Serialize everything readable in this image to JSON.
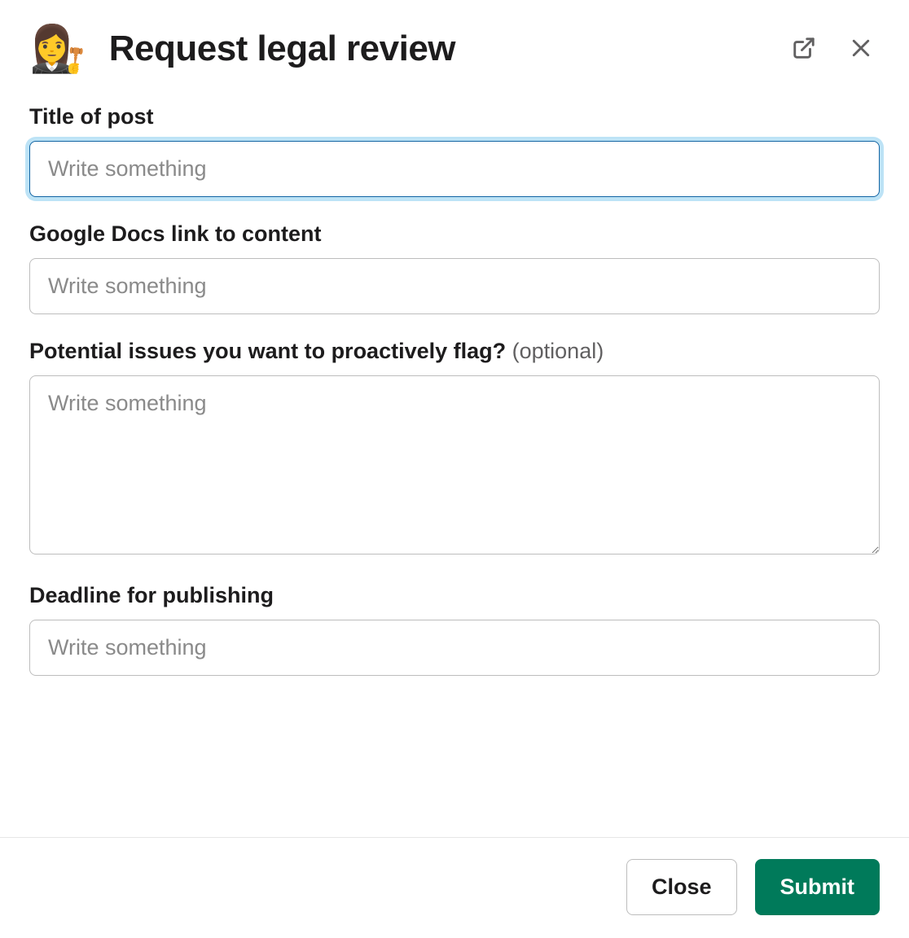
{
  "header": {
    "icon": "👩‍⚖️",
    "title": "Request legal review"
  },
  "fields": {
    "title_of_post": {
      "label": "Title of post",
      "placeholder": "Write something",
      "value": ""
    },
    "gdocs_link": {
      "label": "Google Docs link to content",
      "placeholder": "Write something",
      "value": ""
    },
    "issues": {
      "label": "Potential issues you want to proactively flag? ",
      "optional_text": "(optional)",
      "placeholder": "Write something",
      "value": ""
    },
    "deadline": {
      "label": "Deadline for publishing",
      "placeholder": "Write something",
      "value": ""
    }
  },
  "footer": {
    "close_label": "Close",
    "submit_label": "Submit"
  }
}
